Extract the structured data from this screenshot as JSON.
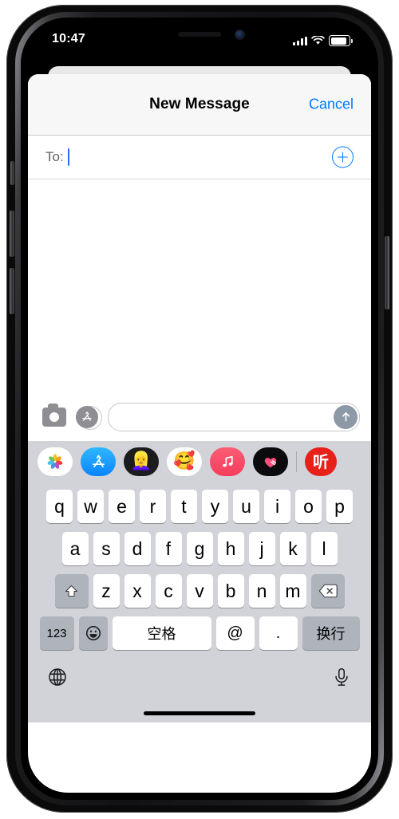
{
  "status_bar": {
    "time": "10:47",
    "signal_icon": "cellular-bars-icon",
    "wifi_icon": "wifi-icon",
    "battery_icon": "battery-full-icon"
  },
  "nav_bar": {
    "title": "New Message",
    "cancel_label": "Cancel"
  },
  "recipient_field": {
    "label": "To:",
    "value": "",
    "add_contact_icon": "plus-circle-icon"
  },
  "compose_bar": {
    "camera_icon": "camera-icon",
    "app_store_icon": "app-store-icon",
    "input_placeholder": "",
    "input_value": "",
    "send_icon": "send-arrow-up-icon"
  },
  "app_drawer": {
    "items": [
      {
        "name": "photos",
        "icon": "photos-app-icon",
        "label": "Photos"
      },
      {
        "name": "app-store",
        "icon": "app-store-app-icon",
        "label": "App Store"
      },
      {
        "name": "animoji",
        "icon": "animoji-app-icon",
        "glyph": "👱‍♀️",
        "label": "Animoji"
      },
      {
        "name": "memoji-stickers",
        "icon": "memoji-stickers-app-icon",
        "glyph": "🥰",
        "label": "Memoji Stickers"
      },
      {
        "name": "apple-music",
        "icon": "apple-music-app-icon",
        "glyph": "♫",
        "label": "Music"
      },
      {
        "name": "digital-touch",
        "icon": "digital-touch-app-icon",
        "glyph": "♥",
        "label": "Digital Touch"
      },
      {
        "name": "ting",
        "icon": "ting-app-icon",
        "glyph": "听",
        "label": "听"
      }
    ]
  },
  "keyboard": {
    "row1": [
      "q",
      "w",
      "e",
      "r",
      "t",
      "y",
      "u",
      "i",
      "o",
      "p"
    ],
    "row2": [
      "a",
      "s",
      "d",
      "f",
      "g",
      "h",
      "j",
      "k",
      "l"
    ],
    "row3": [
      "z",
      "x",
      "c",
      "v",
      "b",
      "n",
      "m"
    ],
    "shift_icon": "shift-up-arrow-icon",
    "delete_icon": "backspace-delete-icon",
    "numbers_label": "123",
    "emoji_icon": "emoji-smiley-icon",
    "space_label": "空格",
    "at_label": "@",
    "dot_label": ".",
    "return_label": "换行",
    "globe_icon": "globe-keyboard-switch-icon",
    "mic_icon": "microphone-dictation-icon"
  },
  "colors": {
    "accent_blue": "#007aff",
    "keyboard_bg": "#d1d3d9",
    "key_white": "#ffffff",
    "key_gray": "#aeb3bc",
    "nav_bg": "#f7f7f7",
    "send_gray": "#8e99a8"
  }
}
